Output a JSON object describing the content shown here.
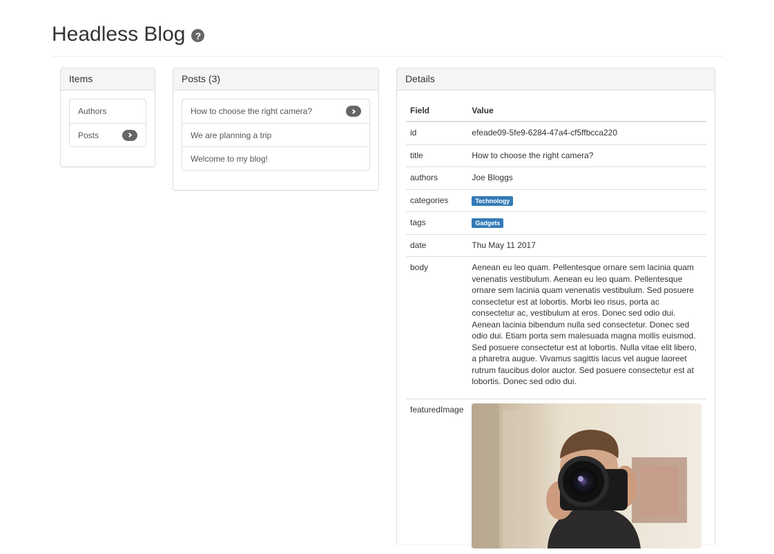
{
  "header": {
    "title": "Headless Blog",
    "help_glyph": "?"
  },
  "items_panel": {
    "heading": "Items",
    "items": [
      {
        "label": "Authors",
        "selected": false
      },
      {
        "label": "Posts",
        "selected": true
      }
    ]
  },
  "posts_panel": {
    "heading": "Posts (3)",
    "items": [
      {
        "label": "How to choose the right camera?",
        "selected": true
      },
      {
        "label": "We are planning a trip",
        "selected": false
      },
      {
        "label": "Welcome to my blog!",
        "selected": false
      }
    ]
  },
  "details_panel": {
    "heading": "Details",
    "columns": {
      "field": "Field",
      "value": "Value"
    },
    "rows": {
      "id": {
        "field": "id",
        "value": "efeade09-5fe9-6284-47a4-cf5ffbcca220"
      },
      "title": {
        "field": "title",
        "value": "How to choose the right camera?"
      },
      "authors": {
        "field": "authors",
        "value": "Joe Bloggs"
      },
      "categories": {
        "field": "categories",
        "badge": "Technology"
      },
      "tags": {
        "field": "tags",
        "badge": "Gadgets"
      },
      "date": {
        "field": "date",
        "value": "Thu May 11 2017"
      },
      "body": {
        "field": "body",
        "value": "Aenean eu leo quam. Pellentesque ornare sem lacinia quam venenatis vestibulum. Aenean eu leo quam. Pellentesque ornare sem lacinia quam venenatis vestibulum. Sed posuere consectetur est at lobortis. Morbi leo risus, porta ac consectetur ac, vestibulum at eros. Donec sed odio dui. Aenean lacinia bibendum nulla sed consectetur. Donec sed odio dui. Etiam porta sem malesuada magna mollis euismod. Sed posuere consectetur est at lobortis. Nulla vitae elit libero, a pharetra augue. Vivamus sagittis lacus vel augue laoreet rutrum faucibus dolor auctor. Sed posuere consectetur est at lobortis. Donec sed odio dui."
      },
      "featuredImage": {
        "field": "featuredImage",
        "image": "photographer-with-camera-photo"
      }
    }
  },
  "colors": {
    "badge": "#337ab7",
    "chevron_badge": "#666666",
    "panel_heading_bg": "#f5f5f5",
    "border": "#dddddd"
  }
}
